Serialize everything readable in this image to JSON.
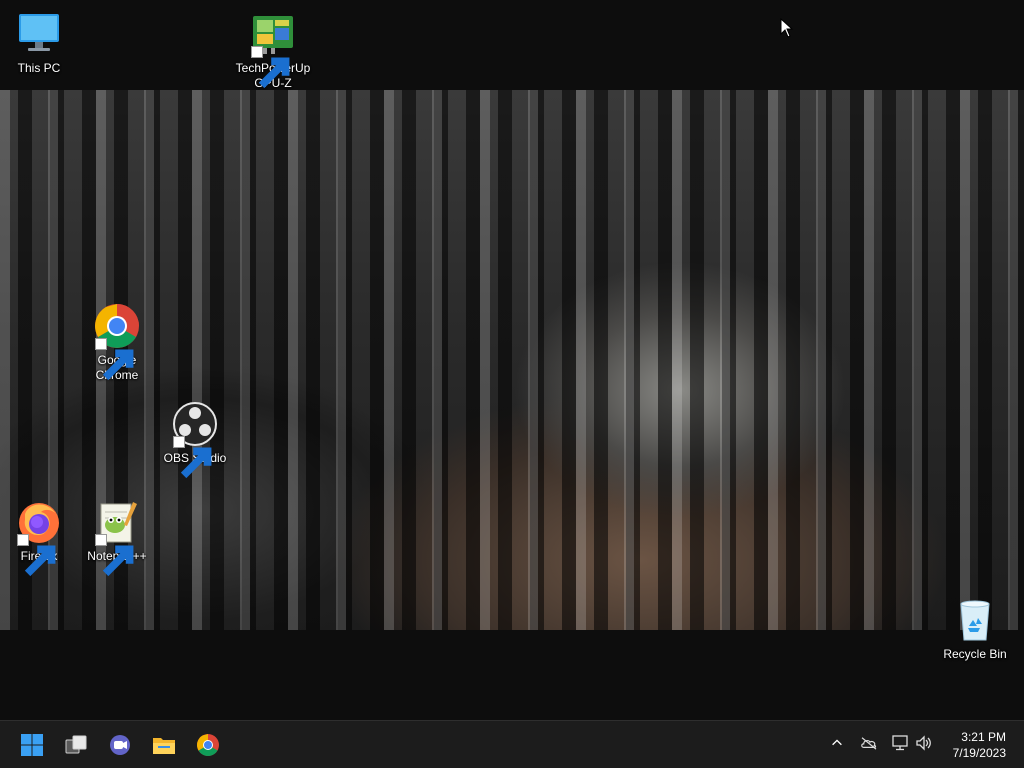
{
  "desktop": {
    "icons": [
      {
        "label": "This PC",
        "icon": "this-pc-icon"
      },
      {
        "label": "TechPowerUp GPU-Z",
        "icon": "gpu-z-icon"
      },
      {
        "label": "Google Chrome",
        "icon": "chrome-icon"
      },
      {
        "label": "OBS Studio",
        "icon": "obs-icon"
      },
      {
        "label": "Firefox",
        "icon": "firefox-icon"
      },
      {
        "label": "Notepad++",
        "icon": "notepad-plus-plus-icon"
      },
      {
        "label": "Recycle Bin",
        "icon": "recycle-bin-icon"
      }
    ]
  },
  "taskbar": {
    "pinned": [
      "start-icon",
      "task-view-icon",
      "teams-chat-icon",
      "file-explorer-icon",
      "chrome-icon"
    ],
    "tray": [
      "show-hidden-icons-icon",
      "onedrive-icon",
      "network-icon",
      "volume-icon"
    ],
    "clock": {
      "time": "3:21 PM",
      "date": "7/19/2023"
    }
  },
  "colors": {
    "taskbar_bg": "#1c1c1c",
    "accent_blue": "#0a84e0"
  }
}
